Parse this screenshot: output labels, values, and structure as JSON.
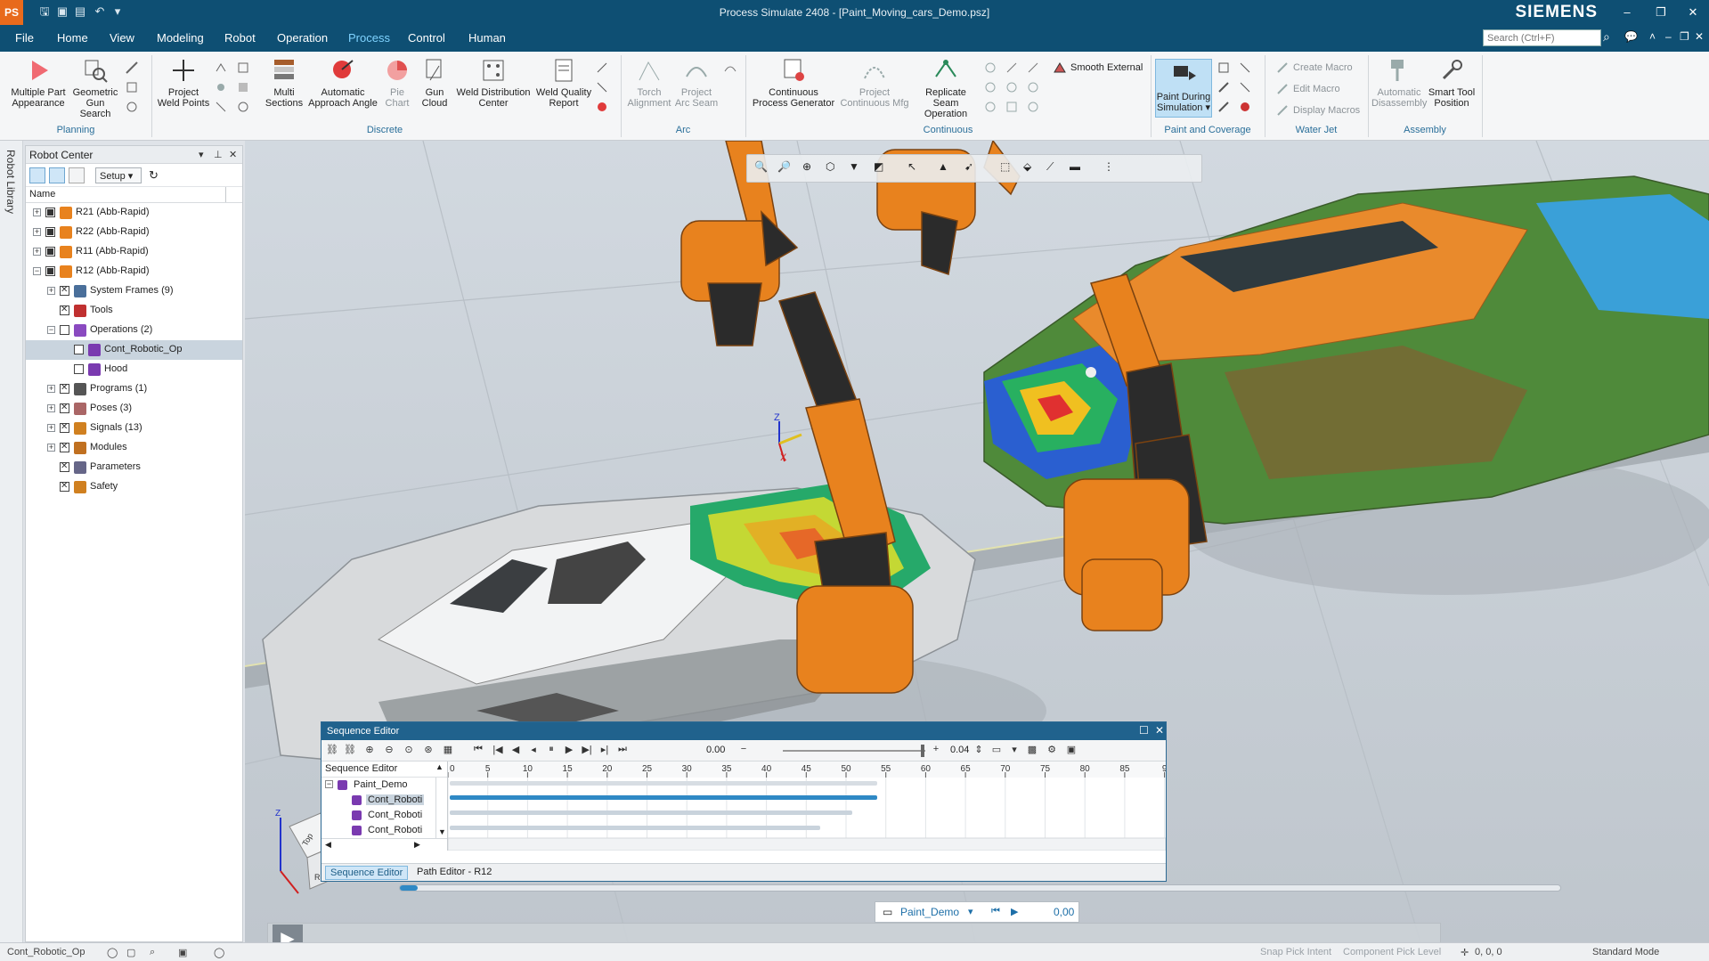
{
  "app": {
    "title": "Process Simulate 2408 - [Paint_Moving_cars_Demo.psz]",
    "brand": "SIEMENS",
    "logo": "PS"
  },
  "menu": {
    "items": [
      "File",
      "Home",
      "View",
      "Modeling",
      "Robot",
      "Operation",
      "Process",
      "Control",
      "Human"
    ],
    "active": "Process",
    "search_placeholder": "Search (Ctrl+F)"
  },
  "ribbon": {
    "planning": {
      "group": "Planning",
      "multiple_part": "Multiple Part",
      "appearance": "Appearance",
      "geometric": "Geometric",
      "gun_search": "Gun Search"
    },
    "discrete": {
      "group": "Discrete",
      "project": "Project",
      "weld_points": "Weld Points",
      "multi": "Multi",
      "sections": "Sections",
      "automatic": "Automatic",
      "approach_angle": "Approach Angle",
      "pie": "Pie",
      "chart": "Chart",
      "gun": "Gun",
      "cloud": "Cloud",
      "weld_distribution": "Weld Distribution",
      "center": "Center",
      "weld_quality": "Weld Quality",
      "report": "Report"
    },
    "arc": {
      "group": "Arc",
      "torch": "Torch",
      "alignment": "Alignment",
      "project": "Project",
      "arc_seam": "Arc Seam"
    },
    "continuous": {
      "group": "Continuous",
      "continuous": "Continuous",
      "process_generator": "Process Generator",
      "project": "Project",
      "continuous_mfg": "Continuous Mfg",
      "replicate_seam": "Replicate Seam",
      "operation": "Operation",
      "smooth_external": "Smooth External"
    },
    "paint": {
      "group": "Paint and Coverage",
      "paint_during": "Paint During",
      "simulation": "Simulation"
    },
    "waterjet": {
      "group": "Water Jet",
      "create_macro": "Create Macro",
      "edit_macro": "Edit Macro",
      "display_macros": "Display Macros"
    },
    "assembly": {
      "group": "Assembly",
      "automatic": "Automatic",
      "disassembly": "Disassembly",
      "smart_tool": "Smart Tool",
      "position": "Position"
    }
  },
  "side_tab": "Robot Library",
  "robot_center": {
    "title": "Robot Center",
    "setup": "Setup",
    "column": "Name",
    "tree": [
      {
        "label": "R21 (Abb-Rapid)",
        "indent": 0,
        "exp": "+",
        "check": "on",
        "icon": "robot"
      },
      {
        "label": "R22 (Abb-Rapid)",
        "indent": 0,
        "exp": "+",
        "check": "on",
        "icon": "robot"
      },
      {
        "label": "R11 (Abb-Rapid)",
        "indent": 0,
        "exp": "+",
        "check": "on",
        "icon": "robot"
      },
      {
        "label": "R12 (Abb-Rapid)",
        "indent": 0,
        "exp": "−",
        "check": "on",
        "icon": "robot"
      },
      {
        "label": "System Frames (9)",
        "indent": 1,
        "exp": "+",
        "check": "x",
        "icon": "frame"
      },
      {
        "label": "Tools",
        "indent": 1,
        "exp": "",
        "check": "x",
        "icon": "tool"
      },
      {
        "label": "Operations (2)",
        "indent": 1,
        "exp": "−",
        "check": "",
        "icon": "ops"
      },
      {
        "label": "Cont_Robotic_Op",
        "indent": 2,
        "exp": "",
        "check": "",
        "icon": "op",
        "selected": true
      },
      {
        "label": "Hood",
        "indent": 2,
        "exp": "",
        "check": "",
        "icon": "op"
      },
      {
        "label": "Programs (1)",
        "indent": 1,
        "exp": "+",
        "check": "x",
        "icon": "prog"
      },
      {
        "label": "Poses (3)",
        "indent": 1,
        "exp": "+",
        "check": "x",
        "icon": "pose"
      },
      {
        "label": "Signals (13)",
        "indent": 1,
        "exp": "+",
        "check": "x",
        "icon": "signal"
      },
      {
        "label": "Modules",
        "indent": 1,
        "exp": "+",
        "check": "x",
        "icon": "module"
      },
      {
        "label": "Parameters",
        "indent": 1,
        "exp": "",
        "check": "x",
        "icon": "param"
      },
      {
        "label": "Safety",
        "indent": 1,
        "exp": "",
        "check": "x",
        "icon": "safety"
      }
    ]
  },
  "sequence_editor": {
    "title": "Sequence Editor",
    "time": "0.00",
    "step": "0.04",
    "tree_header": "Sequence Editor",
    "rows": [
      {
        "label": "Paint_Demo",
        "level": 0
      },
      {
        "label": "Cont_Roboti",
        "level": 1,
        "selected": true
      },
      {
        "label": "Cont_Roboti",
        "level": 1
      },
      {
        "label": "Cont_Roboti",
        "level": 1
      }
    ],
    "ticks": [
      "0",
      "5",
      "10",
      "15",
      "20",
      "25",
      "30",
      "35",
      "40",
      "45",
      "50",
      "55",
      "60",
      "65",
      "70",
      "75",
      "80",
      "85",
      "9"
    ],
    "tabs": [
      "Sequence Editor",
      "Path Editor - R12"
    ]
  },
  "player": {
    "name": "Paint_Demo",
    "value": "0,00",
    "progress": 0.015
  },
  "axes": {
    "x": "X",
    "z": "Z",
    "cube_top": "Top",
    "cube_right": "Right"
  },
  "status": {
    "left": "Cont_Robotic_Op",
    "snap": "Snap Pick Intent",
    "component": "Component",
    "pick_level": "Pick Level",
    "coords": "0, 0, 0",
    "mode": "Standard Mode"
  },
  "colors": {
    "accent": "#0e4f73",
    "robot_orange": "#e8821e",
    "car_orange": "#e98a2c",
    "car_green": "#5b8a35",
    "highlight": "#2f89c5"
  }
}
